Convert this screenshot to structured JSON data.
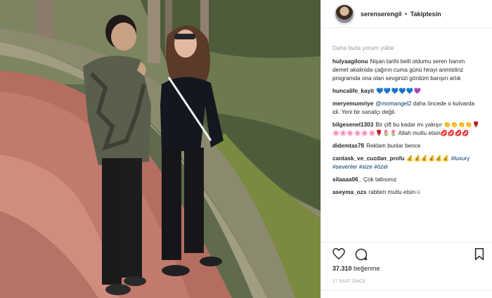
{
  "post": {
    "username": "serenserengil",
    "separator": "•",
    "follow_status": "Takiptesin"
  },
  "comments_section": {
    "load_more": "Daha fazla yorum yükle",
    "comments": [
      {
        "user": "hulyaagilonu",
        "text": "Nişan tarihi belli oldumu seren hanım demet akalinida çağırın cuma günü hirayi anmistinz programda ona olan sevginizi gördüm barışın artık"
      },
      {
        "user": "huncalife_kayit",
        "text": "💙💙💙💙💙💜"
      },
      {
        "user": "meryemumriye",
        "mention": "@momangel2",
        "text": " daha öncede o kulvarda idi. Yeni bir sanatçı değil."
      },
      {
        "user": "bilgesenel1303",
        "text": "Bir çift bu kadar mı yakışır 👏👏👏👏🌹🌸🌸🌸🌸🌸🌸🌹🌷🌷 Allah mutlu etsin💋💋💋💋"
      },
      {
        "user": "didemtas78",
        "text": "Reklam bunlar bence"
      },
      {
        "user": "cantask_ve_cuzdan_profu",
        "text": "💰💰💰💰💰💰 ",
        "hashtags": "#luxury #sevenler #size #özel"
      },
      {
        "user": "silaaaa06_",
        "text": "Çok tatlısınız"
      },
      {
        "user": "aseyma_ozs",
        "text": "rabbim mutlu etsin☺"
      }
    ]
  },
  "actions": {
    "like_icon": "heart-icon",
    "comment_icon": "comment-bubble-icon",
    "save_icon": "bookmark-icon"
  },
  "stats": {
    "likes_count": "37.310",
    "likes_label": "beğenme",
    "time_ago": "17 SAAT ÖNCE"
  },
  "colors": {
    "border": "#efefef",
    "text": "#262626",
    "muted": "#999999",
    "link": "#003569"
  }
}
